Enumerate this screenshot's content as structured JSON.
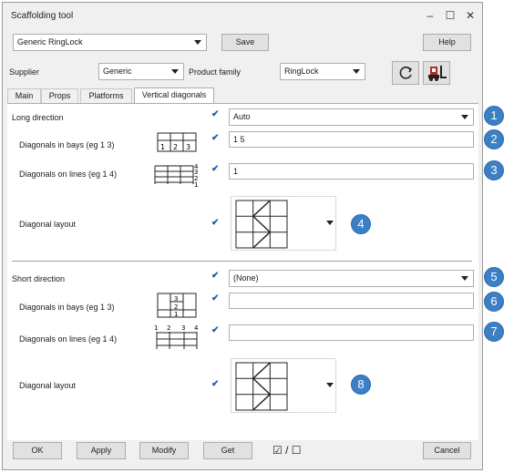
{
  "window": {
    "title": "Scaffolding tool",
    "controls": {
      "minimize": "–",
      "maximize": "☐",
      "close": "✕"
    }
  },
  "toolbar": {
    "preset_value": "Generic RingLock",
    "save_label": "Save",
    "help_label": "Help",
    "supplier_label": "Supplier",
    "supplier_value": "Generic",
    "product_family_label": "Product family",
    "product_family_value": "RingLock"
  },
  "tabs": [
    {
      "label": "Main"
    },
    {
      "label": "Props"
    },
    {
      "label": "Platforms"
    },
    {
      "label": "Vertical diagonals"
    }
  ],
  "long": {
    "label": "Long direction",
    "value": "Auto",
    "bays_label": "Diagonals in bays (eg 1 3)",
    "bays_value": "1 5",
    "bays_icon_nums": [
      "1",
      "2",
      "3"
    ],
    "lines_label": "Diagonals on lines (eg 1 4)",
    "lines_value": "1",
    "lines_icon_nums": [
      "4",
      "3",
      "2",
      "1"
    ],
    "layout_label": "Diagonal layout"
  },
  "short": {
    "label": "Short direction",
    "value": "(None)",
    "bays_label": "Diagonals in bays (eg 1 3)",
    "bays_value": "",
    "bays_icon_nums": [
      "3",
      "2",
      "1"
    ],
    "lines_label": "Diagonals on lines (eg 1 4)",
    "lines_value": "",
    "lines_icon_nums": [
      "1",
      "2",
      "3",
      "4"
    ],
    "layout_label": "Diagonal layout"
  },
  "callouts": [
    "1",
    "2",
    "3",
    "4",
    "5",
    "6",
    "7",
    "8"
  ],
  "footer": {
    "ok": "OK",
    "apply": "Apply",
    "modify": "Modify",
    "get": "Get",
    "toggle": "☑ / ☐",
    "cancel": "Cancel"
  },
  "colors": {
    "callout": "#3c7fc4",
    "check": "#1d5fa8"
  },
  "icons": {
    "refresh": "refresh-icon",
    "forklift": "forklift-icon"
  }
}
